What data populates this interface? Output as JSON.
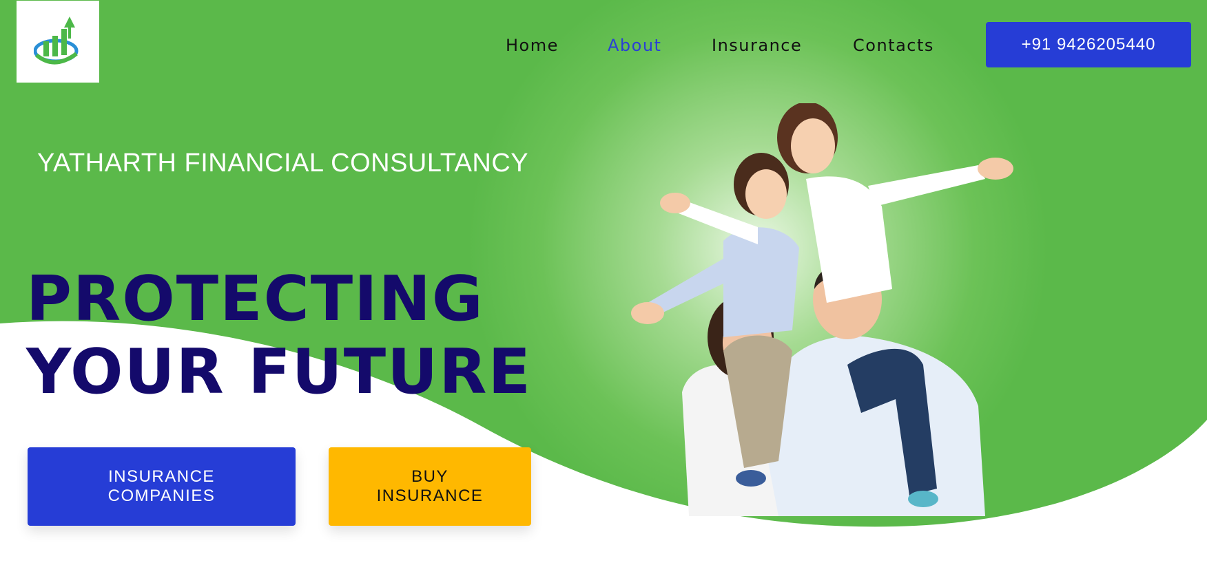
{
  "brand": {
    "logo_icon": "growth-chart-logo-icon",
    "company_name": "YATHARTH FINANCIAL CONSULTANCY"
  },
  "nav": {
    "items": [
      {
        "label": "Home",
        "active": false
      },
      {
        "label": "About",
        "active": true
      },
      {
        "label": "Insurance",
        "active": false
      },
      {
        "label": "Contacts",
        "active": false
      }
    ],
    "phone_label": "+91 9426205440"
  },
  "hero": {
    "headline_line1": "PROTECTING",
    "headline_line2": "YOUR FUTURE",
    "buttons": {
      "companies_line1": "INSURANCE",
      "companies_line2": "COMPANIES",
      "buy_line1": "BUY",
      "buy_line2": "INSURANCE"
    },
    "image": "happy-family-photo"
  },
  "colors": {
    "hero_green": "#5bb94a",
    "primary_blue": "#263dd6",
    "headline_navy": "#140a6b",
    "cta_yellow": "#ffb800",
    "nav_active": "#2a3fd6"
  }
}
